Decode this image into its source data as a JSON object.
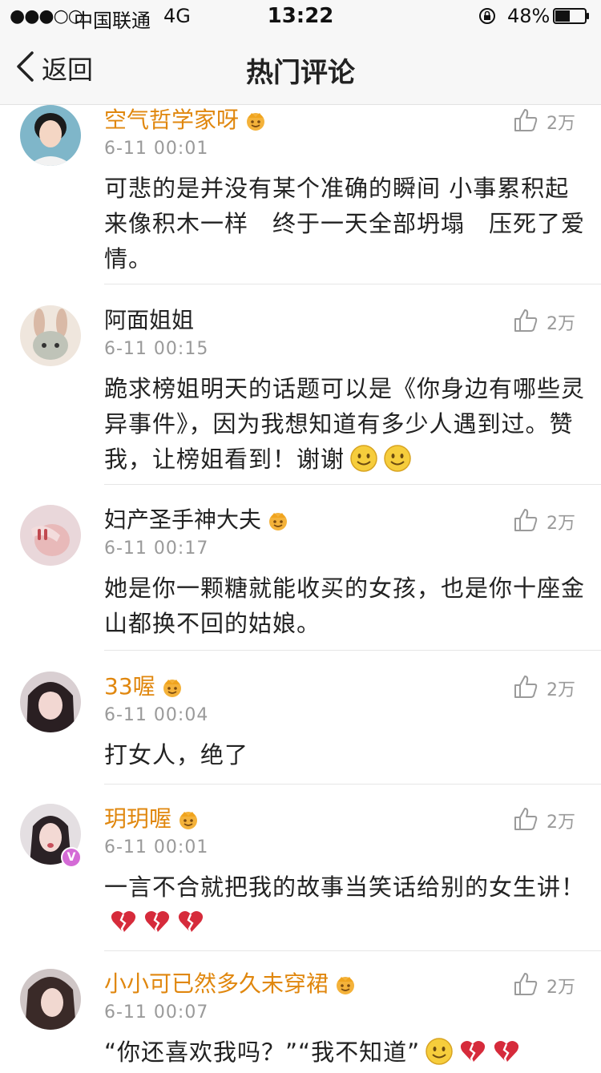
{
  "status_bar": {
    "signal": "●●●○○",
    "carrier": "中国联通",
    "network": "4G",
    "time": "13:22",
    "battery_percent": "48%"
  },
  "nav": {
    "back_label": "返回",
    "title": "热门评论"
  },
  "colors": {
    "vip_name": "#e0870e",
    "normal_name": "#222222",
    "meta": "#9a9a9a"
  },
  "comments": [
    {
      "username": "空气哲学家呀",
      "vip": true,
      "time": "6-11 00:01",
      "likes": "2万",
      "text": "可悲的是并没有某个准确的瞬间 小事累积起来像积木一样　终于一天全部坍塌　压死了爱情。"
    },
    {
      "username": "阿面姐姐",
      "vip": false,
      "time": "6-11 00:15",
      "likes": "2万",
      "text": "跪求榜姐明天的话题可以是《你身边有哪些灵异事件》，因为我想知道有多少人遇到过。赞我，让榜姐看到！谢谢",
      "emojis": [
        "smile-emoji",
        "smile-emoji"
      ]
    },
    {
      "username": "妇产圣手神大夫",
      "vip": true,
      "time": "6-11 00:17",
      "likes": "2万",
      "text": "她是你一颗糖就能收买的女孩，也是你十座金山都换不回的姑娘。"
    },
    {
      "username": "33喔",
      "vip": true,
      "time": "6-11 00:04",
      "likes": "2万",
      "text": "打女人，绝了"
    },
    {
      "username": "玥玥喔",
      "vip": true,
      "time": "6-11 00:01",
      "likes": "2万",
      "text": "一言不合就把我的故事当笑话给别的女生讲！",
      "emojis": [
        "broken-heart-emoji",
        "broken-heart-emoji",
        "broken-heart-emoji"
      ]
    },
    {
      "username": "小小可已然多久未穿裙",
      "vip": true,
      "time": "6-11 00:07",
      "likes": "2万",
      "text": "“你还喜欢我吗？”“我不知道”",
      "emojis": [
        "smile-emoji",
        "broken-heart-emoji",
        "broken-heart-emoji"
      ]
    }
  ]
}
